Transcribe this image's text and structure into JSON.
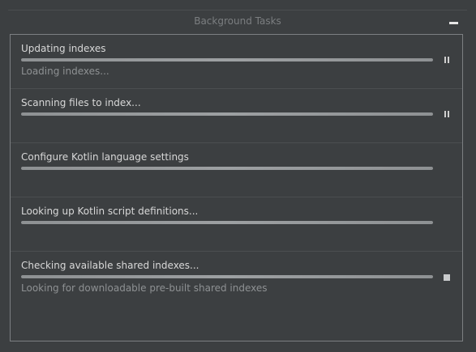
{
  "window": {
    "title": "Background Tasks",
    "minimize_icon": "minimize-icon"
  },
  "tasks": [
    {
      "label": "Updating indexes",
      "subtext": "Loading indexes...",
      "progress": 1.0,
      "control": "pause"
    },
    {
      "label": "Scanning files to index...",
      "subtext": "",
      "progress": 1.0,
      "control": "pause"
    },
    {
      "label": "Configure Kotlin language settings",
      "subtext": "",
      "progress": 1.0,
      "control": "none"
    },
    {
      "label": "Looking up Kotlin script definitions...",
      "subtext": "",
      "progress": 1.0,
      "control": "none"
    },
    {
      "label": "Checking available shared indexes...",
      "subtext": "Looking for downloadable pre-built shared indexes",
      "progress": 1.0,
      "control": "stop"
    }
  ],
  "colors": {
    "background": "#3c3f41",
    "text": "#d8d8d8",
    "subtext": "#8e9193",
    "border": "#7c7f82"
  }
}
